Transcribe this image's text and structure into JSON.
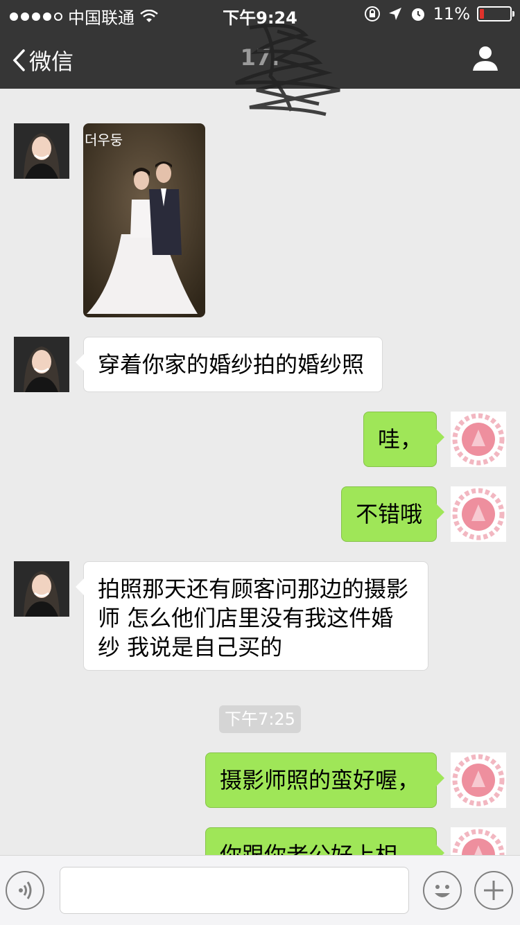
{
  "status_bar": {
    "carrier": "中国联通",
    "time": "下午9:24",
    "battery": "11%",
    "battery_level": 0.11
  },
  "nav": {
    "back_label": "微信",
    "title": "17."
  },
  "messages": [
    {
      "type": "image",
      "side": "left",
      "alt": "wedding photo",
      "overlay_text": "더우둥"
    },
    {
      "type": "text",
      "side": "left",
      "text": "穿着你家的婚纱拍的婚纱照"
    },
    {
      "type": "text",
      "side": "right",
      "text": "哇，"
    },
    {
      "type": "text",
      "side": "right",
      "text": "不错哦"
    },
    {
      "type": "text",
      "side": "left",
      "lines": [
        "拍照那天还有顾客问那边的摄影",
        "师 怎么他们店里没有我这件婚",
        "纱 我说是自己买的"
      ]
    },
    {
      "type": "timestamp",
      "text": "下午7:25"
    },
    {
      "type": "text",
      "side": "right",
      "text": "摄影师照的蛮好喔，"
    },
    {
      "type": "text",
      "side": "right",
      "text": "你跟你老公好上相"
    }
  ],
  "input_bar": {
    "voice_icon": "voice-icon",
    "emoji_icon": "emoji-icon",
    "plus_icon": "plus-icon",
    "placeholder": ""
  },
  "colors": {
    "nav_bg": "#363636",
    "chat_bg": "#ebebeb",
    "outgoing_bubble": "#9fe658",
    "incoming_bubble": "#ffffff",
    "battery_low": "#e0322b"
  }
}
